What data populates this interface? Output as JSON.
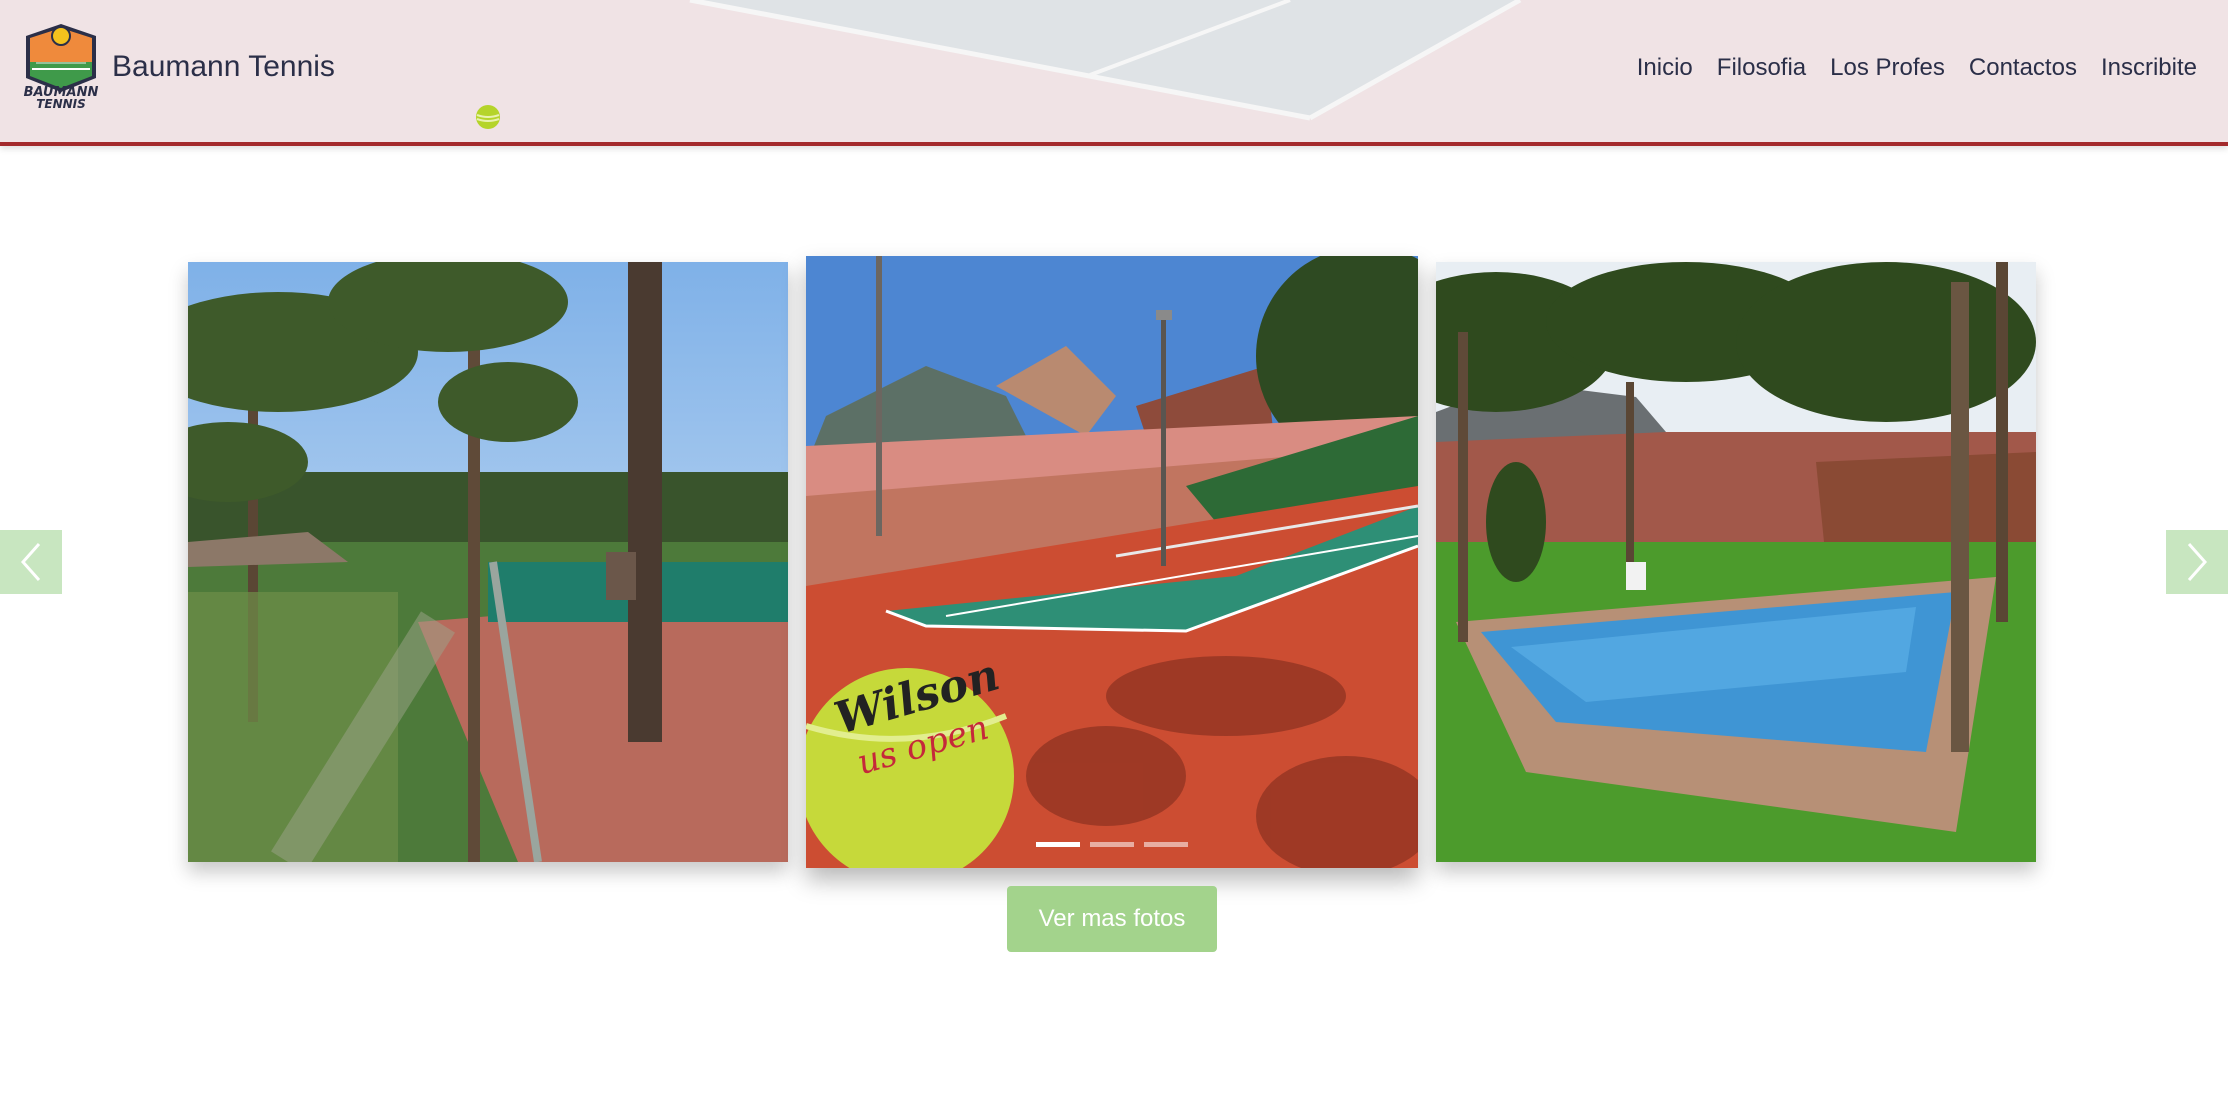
{
  "brand": {
    "name": "Baumann Tennis",
    "logo_text_top": "BAUMANN",
    "logo_text_bottom": "TENNIS"
  },
  "nav": {
    "items": [
      "Inicio",
      "Filosofia",
      "Los Profes",
      "Contactos",
      "Inscribite"
    ]
  },
  "carousel": {
    "slides": [
      {
        "description_icon": "palm-court-photo"
      },
      {
        "description_icon": "tennis-court-photo",
        "ball_text_top": "Wilson",
        "ball_text_bottom": "us open"
      },
      {
        "description_icon": "pool-photo"
      }
    ],
    "indicator_count": 3,
    "active_index": 0
  },
  "more_button": {
    "label": "Ver mas fotos"
  },
  "colors": {
    "navbar_bg": "#f0e3e5",
    "navbar_border": "#a32a2c",
    "text": "#2b2f48",
    "accent_green": "#a3d38c",
    "arrow_bg": "#c8e6c0"
  }
}
